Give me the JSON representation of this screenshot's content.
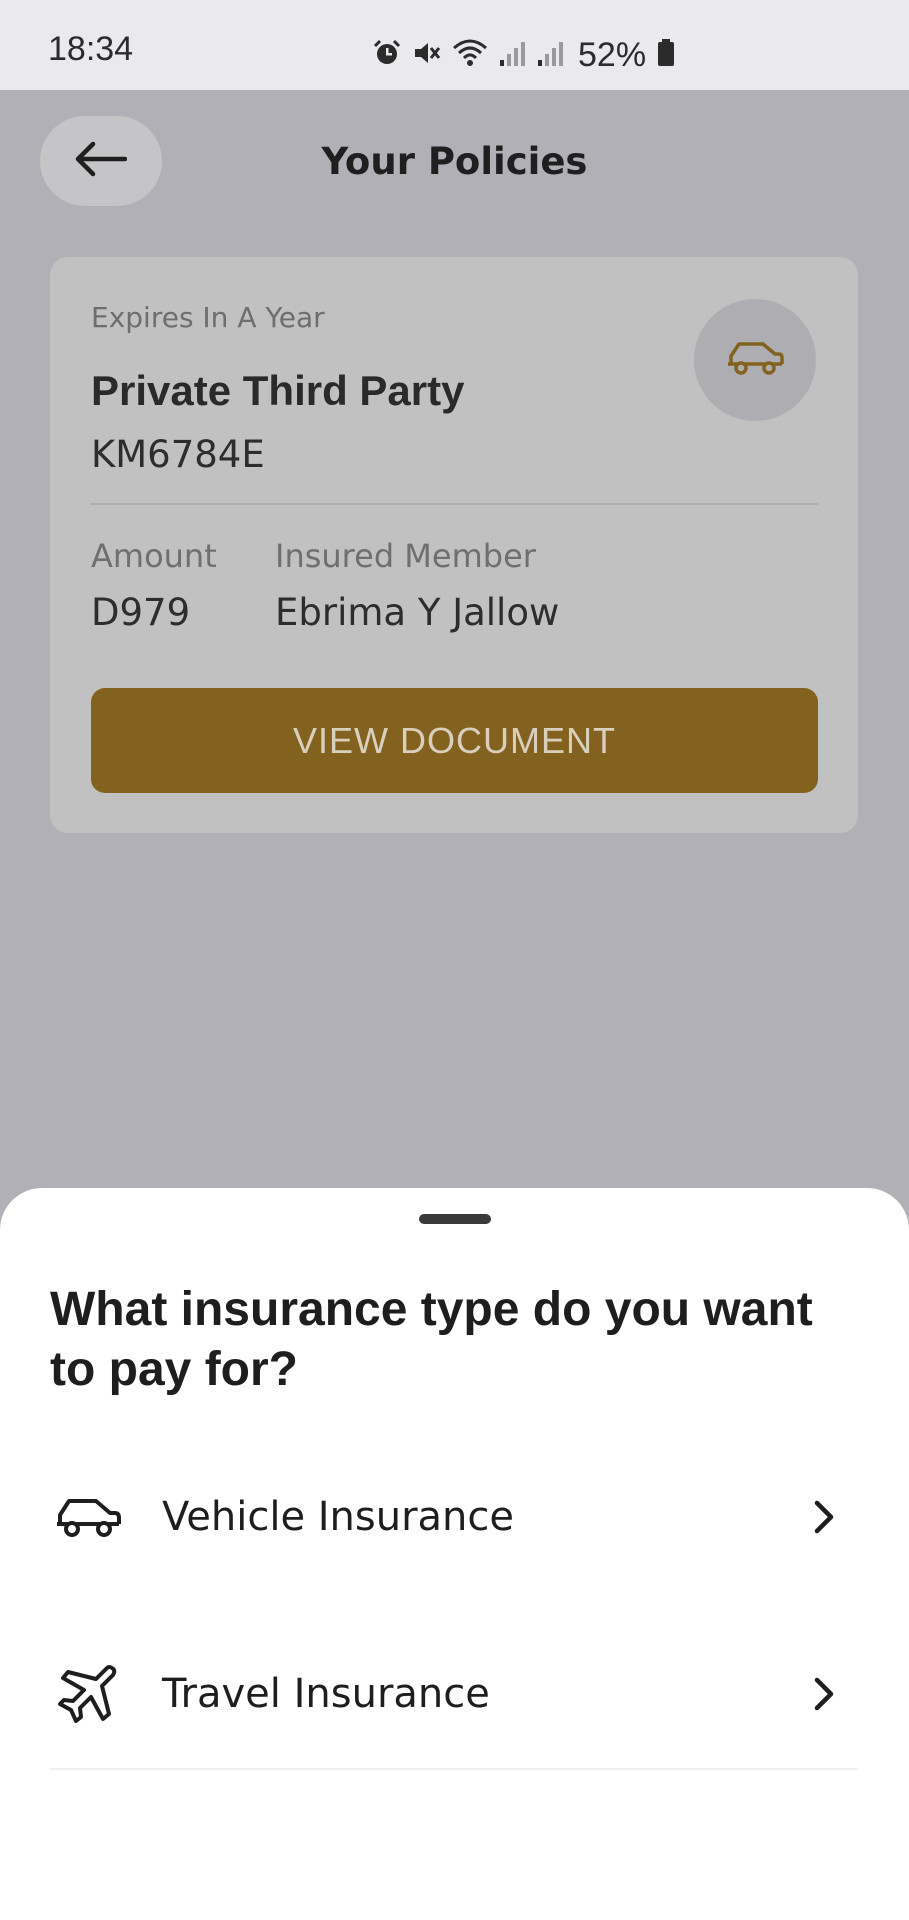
{
  "status_bar": {
    "time": "18:34",
    "battery": "52%",
    "icons": [
      "alarm-icon",
      "mute-icon",
      "wifi-icon",
      "signal-icon",
      "signal-icon",
      "battery-icon"
    ]
  },
  "header": {
    "title": "Your Policies",
    "back_icon": "arrow-left-icon"
  },
  "policy": {
    "expires": "Expires In A Year",
    "name": "Private Third Party",
    "number": "KM6784E",
    "icon": "car-icon",
    "amount_label": "Amount",
    "amount_value": "D979",
    "member_label": "Insured Member",
    "member_value": "Ebrima Y Jallow",
    "button_label": "VIEW DOCUMENT"
  },
  "sheet": {
    "title": "What insurance type do you want to pay for?",
    "options": [
      {
        "label": "Vehicle Insurance",
        "icon": "car-icon"
      },
      {
        "label": "Travel Insurance",
        "icon": "airplane-icon"
      }
    ]
  },
  "colors": {
    "accent": "#836220",
    "overlay": "#b1b0b6",
    "card": "#c1c1c2",
    "sheet": "#ffffff"
  }
}
